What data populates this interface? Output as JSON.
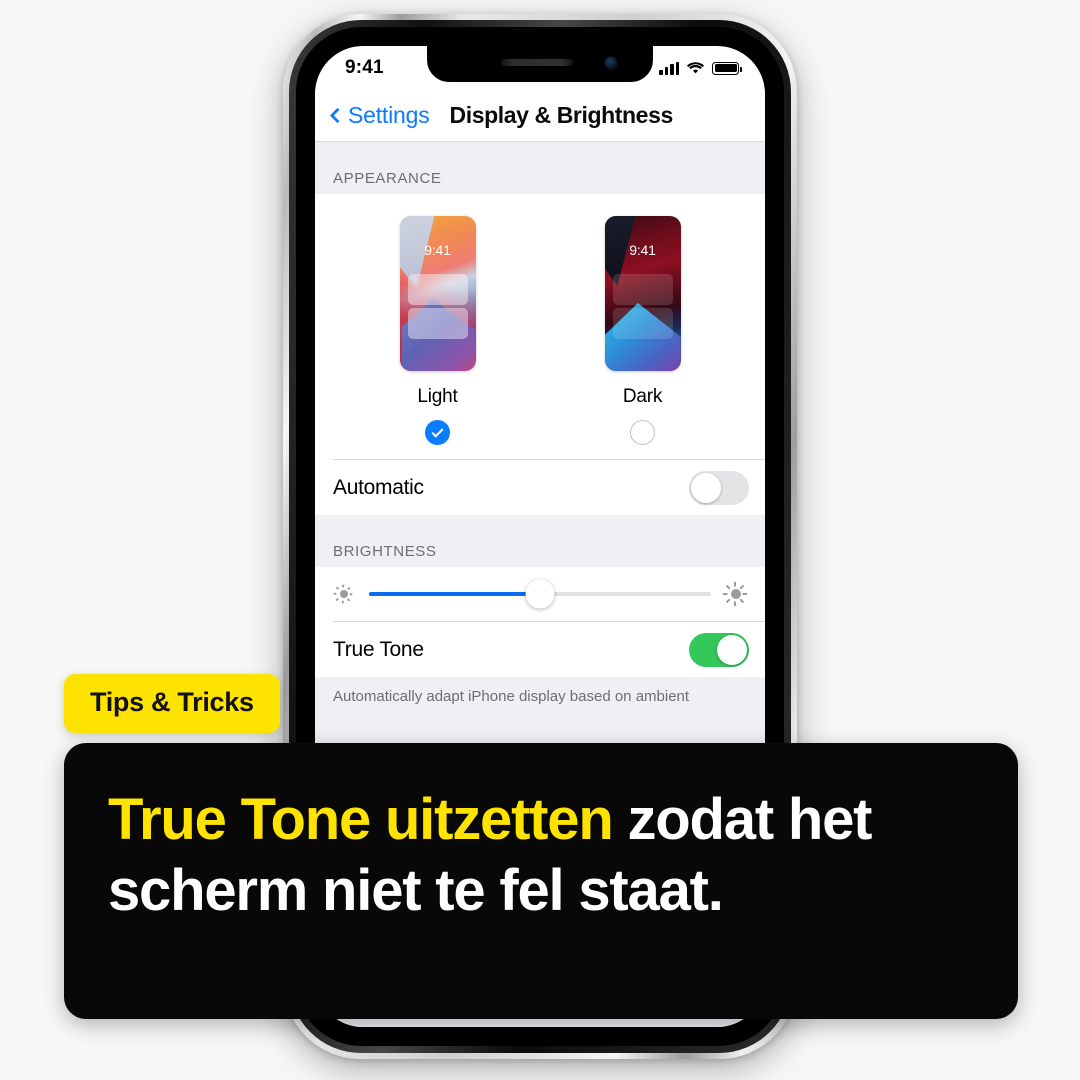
{
  "background_color": "#f7f7f7",
  "phone": {
    "status_bar": {
      "time": "9:41",
      "icons": [
        "cellular-signal-icon",
        "wifi-icon",
        "battery-icon"
      ]
    },
    "nav_bar": {
      "back_label": "Settings",
      "back_icon": "chevron-left-icon",
      "title": "Display & Brightness"
    },
    "sections": [
      {
        "header": "APPEARANCE",
        "appearance_options": [
          {
            "label": "Light",
            "selected": true,
            "thumb_time": "9:41",
            "check_icon": "checkmark-icon"
          },
          {
            "label": "Dark",
            "selected": false,
            "thumb_time": "9:41",
            "check_icon": "radio-empty-icon"
          }
        ],
        "rows": [
          {
            "label": "Automatic",
            "control": "toggle",
            "value": "off"
          }
        ]
      },
      {
        "header": "BRIGHTNESS",
        "slider": {
          "name": "brightness-slider",
          "value_percent": 50,
          "left_icon": "sun-low-icon",
          "right_icon": "sun-high-icon",
          "fill_color": "#0a6cf0"
        },
        "rows": [
          {
            "label": "True Tone",
            "control": "toggle",
            "value": "on",
            "on_color": "#34c759"
          }
        ],
        "footnote": "Automatically adapt iPhone display based on ambient"
      }
    ],
    "side_buttons": [
      "mute-switch",
      "volume-up-button",
      "volume-down-button",
      "power-button"
    ],
    "home_indicator": true
  },
  "overlay": {
    "badge_label": "Tips & Tricks",
    "badge_color": "#ffe300",
    "caption": {
      "highlight_text": "True Tone uitzetten",
      "rest_text": " zodat het scherm niet te fel staat.",
      "highlight_color": "#ffe300",
      "text_color": "#ffffff",
      "background_color": "#080809"
    }
  }
}
